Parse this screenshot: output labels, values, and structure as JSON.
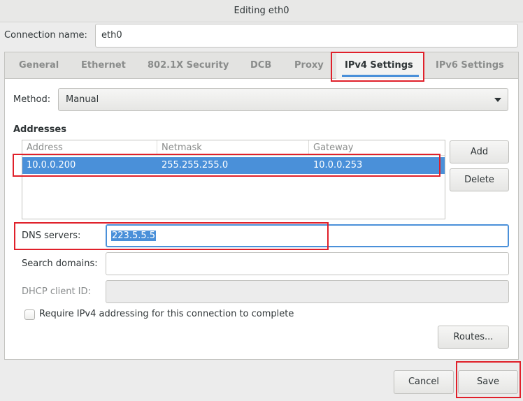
{
  "window": {
    "title": "Editing eth0"
  },
  "connection": {
    "label": "Connection name:",
    "value": "eth0"
  },
  "tabs": [
    {
      "label": "General"
    },
    {
      "label": "Ethernet"
    },
    {
      "label": "802.1X Security"
    },
    {
      "label": "DCB"
    },
    {
      "label": "Proxy"
    },
    {
      "label": "IPv4 Settings",
      "active": true
    },
    {
      "label": "IPv6 Settings"
    }
  ],
  "method": {
    "label": "Method:",
    "value": "Manual"
  },
  "addresses": {
    "heading": "Addresses",
    "columns": [
      "Address",
      "Netmask",
      "Gateway"
    ],
    "rows": [
      {
        "address": "10.0.0.200",
        "netmask": "255.255.255.0",
        "gateway": "10.0.0.253",
        "selected": true
      }
    ],
    "add_label": "Add",
    "delete_label": "Delete"
  },
  "dns": {
    "label": "DNS servers:",
    "value": "223.5.5.5"
  },
  "search_domains": {
    "label": "Search domains:",
    "value": ""
  },
  "dhcp_client_id": {
    "label": "DHCP client ID:",
    "value": ""
  },
  "require_ipv4": {
    "label": "Require IPv4 addressing for this connection to complete",
    "checked": false
  },
  "routes_label": "Routes...",
  "buttons": {
    "cancel": "Cancel",
    "save": "Save"
  },
  "colors": {
    "accent": "#4a90d9",
    "annotation": "#e0202a"
  }
}
